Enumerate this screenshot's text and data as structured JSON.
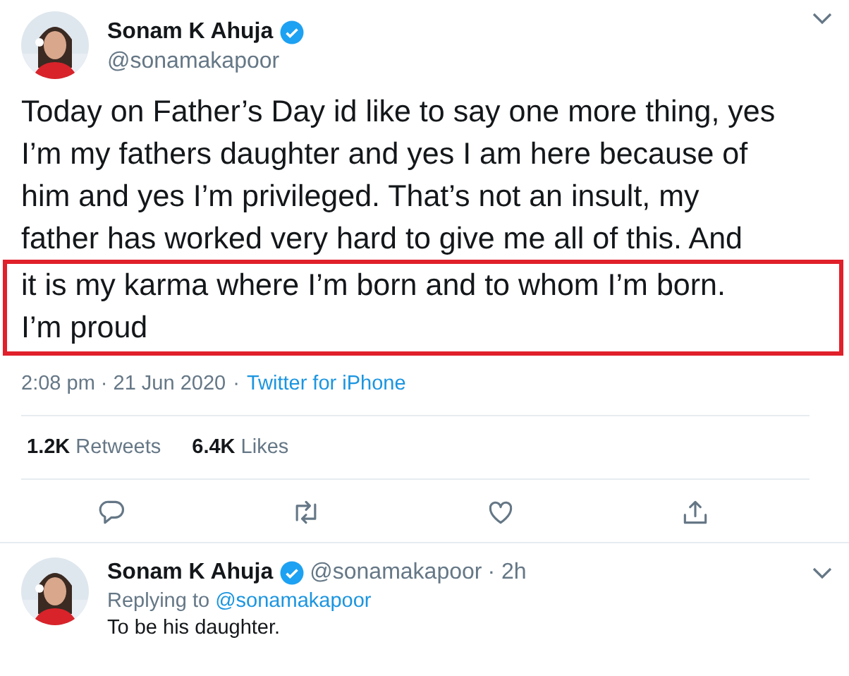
{
  "tweet": {
    "author": {
      "name": "Sonam K Ahuja",
      "verified": true,
      "handle": "@sonamakapoor"
    },
    "body_lines": [
      "Today on Father’s Day id like to say one more thing, yes",
      "I’m my fathers daughter and yes I am here because of",
      "him and yes I’m privileged. That’s not an insult, my",
      "father has worked very hard to give me all of this. And"
    ],
    "highlighted_lines": [
      "it is my karma where I’m born and to whom I’m born.",
      "I’m proud"
    ],
    "time": "2:08 pm · 21 Jun 2020",
    "separator": "·",
    "source": "Twitter for iPhone",
    "stats": [
      {
        "count": "1.2K",
        "label": "Retweets"
      },
      {
        "count": "6.4K",
        "label": "Likes"
      }
    ],
    "actions": [
      {
        "kind": "reply"
      },
      {
        "kind": "retweet"
      },
      {
        "kind": "like"
      },
      {
        "kind": "share"
      }
    ]
  },
  "reply": {
    "author": {
      "name": "Sonam K Ahuja",
      "verified": true,
      "handle": "@sonamakapoor"
    },
    "age": "· 2h",
    "replying_prefix": "Replying to",
    "replying_handle": "@sonamakapoor",
    "text": "To be his daughter."
  }
}
